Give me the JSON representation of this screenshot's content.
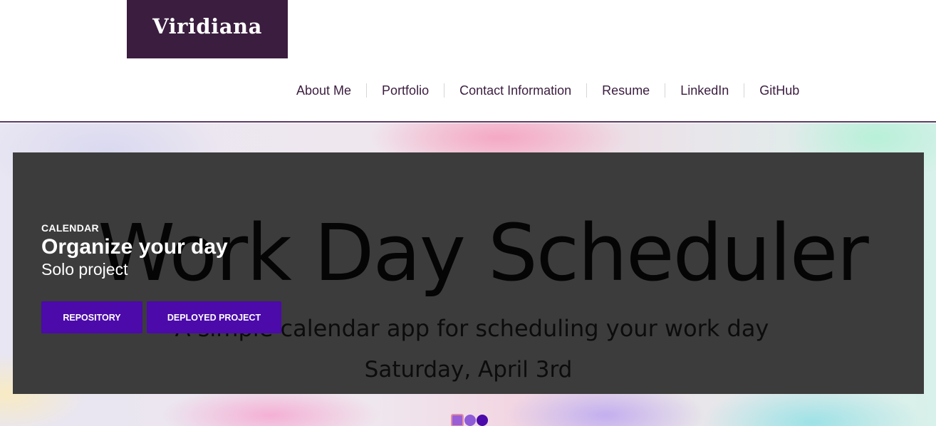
{
  "site": {
    "logo_text": "Viridiana"
  },
  "nav": {
    "items": [
      {
        "label": "About Me"
      },
      {
        "label": "Portfolio"
      },
      {
        "label": "Contact Information"
      },
      {
        "label": "Resume"
      },
      {
        "label": "LinkedIn"
      },
      {
        "label": "GitHub"
      }
    ]
  },
  "slide": {
    "image_text": {
      "title": "Work Day Scheduler",
      "subtitle": "A simple calendar app for scheduling your work day",
      "date": "Saturday, April 3rd"
    },
    "caption": {
      "kicker": "CALENDAR",
      "title": "Organize your day",
      "subtitle": "Solo project"
    },
    "buttons": {
      "repository": "REPOSITORY",
      "deployed": "DEPLOYED PROJECT"
    }
  },
  "carousel": {
    "slide_count": 3,
    "active_index": 0
  },
  "colors": {
    "brand": "#3b1d3f",
    "button": "#4b0aa9",
    "slide_bg": "#3c3c3c"
  }
}
